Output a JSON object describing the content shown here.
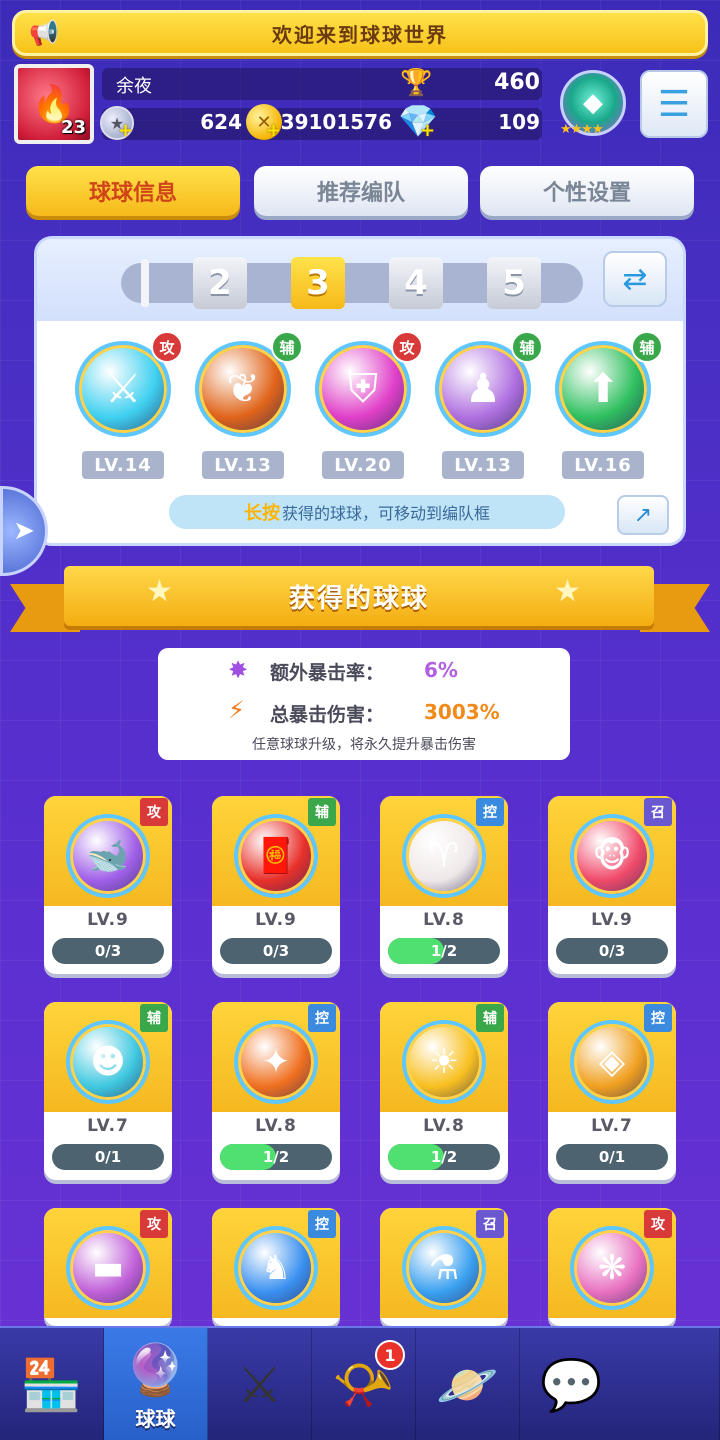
{
  "banner": {
    "text": "欢迎来到球球世界",
    "icon": "megaphone-icon"
  },
  "player": {
    "name": "余夜",
    "level": "23",
    "trophies": "460",
    "silver": "624",
    "gold": "39101576",
    "gems": "109",
    "rank_stars": "★★★★"
  },
  "tabs": [
    {
      "label": "球球信息",
      "active": true
    },
    {
      "label": "推荐编队",
      "active": false
    },
    {
      "label": "个性设置",
      "active": false
    }
  ],
  "team": {
    "slots": [
      "2",
      "3",
      "4",
      "5"
    ],
    "active_slot": "3",
    "balls": [
      {
        "tag": "攻",
        "tag_type": "atk",
        "level": "LV.14",
        "color": "#3fd0f0",
        "icon": "sword-icon"
      },
      {
        "tag": "辅",
        "tag_type": "sup",
        "level": "LV.13",
        "color": "#e0641a",
        "icon": "wings-icon"
      },
      {
        "tag": "攻",
        "tag_type": "atk",
        "level": "LV.20",
        "color": "#e040c8",
        "icon": "shield-bolt-icon"
      },
      {
        "tag": "辅",
        "tag_type": "sup",
        "level": "LV.13",
        "color": "#b070e0",
        "icon": "people-icon"
      },
      {
        "tag": "辅",
        "tag_type": "sup",
        "level": "LV.16",
        "color": "#30c060",
        "icon": "arrow-up-icon"
      }
    ],
    "hint_highlight": "长按",
    "hint_text": "获得的球球，可移动到编队框"
  },
  "collection": {
    "title": "获得的球球",
    "extra_crit_label": "额外暴击率：",
    "extra_crit_value": "6%",
    "total_crit_label": "总暴击伤害：",
    "total_crit_value": "3003%",
    "note": "任意球球升级，将永久提升暴击伤害"
  },
  "cards": [
    {
      "tag": "攻",
      "tag_type": "atk",
      "level": "LV.9",
      "progress_text": "0/3",
      "progress": 0.0,
      "color": "#a060e8",
      "icon": "whale-icon"
    },
    {
      "tag": "辅",
      "tag_type": "sup",
      "level": "LV.9",
      "progress_text": "0/3",
      "progress": 0.0,
      "color": "#e8302a",
      "icon": "red-envelope-icon"
    },
    {
      "tag": "控",
      "tag_type": "ctl",
      "level": "LV.8",
      "progress_text": "1/2",
      "progress": 0.5,
      "color": "#f0e8e8",
      "icon": "ram-icon"
    },
    {
      "tag": "召",
      "tag_type": "sum",
      "level": "LV.9",
      "progress_text": "0/3",
      "progress": 0.0,
      "color": "#f04a6a",
      "icon": "monkey-icon"
    },
    {
      "tag": "辅",
      "tag_type": "sup",
      "level": "LV.7",
      "progress_text": "0/1",
      "progress": 0.0,
      "color": "#40c8e0",
      "icon": "spirit-icon"
    },
    {
      "tag": "控",
      "tag_type": "ctl",
      "level": "LV.8",
      "progress_text": "1/2",
      "progress": 0.5,
      "color": "#f07020",
      "icon": "star-burst-icon"
    },
    {
      "tag": "辅",
      "tag_type": "sup",
      "level": "LV.8",
      "progress_text": "1/2",
      "progress": 0.5,
      "color": "#f8c020",
      "icon": "sun-icon"
    },
    {
      "tag": "控",
      "tag_type": "ctl",
      "level": "LV.7",
      "progress_text": "0/1",
      "progress": 0.0,
      "color": "#f0a020",
      "icon": "gem-icon"
    },
    {
      "tag": "攻",
      "tag_type": "atk",
      "level": "",
      "progress_text": "",
      "progress": 0.0,
      "color": "#c060d8",
      "icon": "belt-icon"
    },
    {
      "tag": "控",
      "tag_type": "ctl",
      "level": "",
      "progress_text": "",
      "progress": 0.0,
      "color": "#3a90f0",
      "icon": "figure-icon"
    },
    {
      "tag": "召",
      "tag_type": "sum",
      "level": "",
      "progress_text": "",
      "progress": 0.0,
      "color": "#3aa0f0",
      "icon": "potion-icon"
    },
    {
      "tag": "攻",
      "tag_type": "atk",
      "level": "",
      "progress_text": "",
      "progress": 0.0,
      "color": "#e870c0",
      "icon": "crystal-icon"
    }
  ],
  "nav": [
    {
      "name": "shop",
      "icon": "shop-icon",
      "label": "",
      "active": false,
      "badge": ""
    },
    {
      "name": "balls",
      "icon": "balls-icon",
      "label": "球球",
      "active": true,
      "badge": ""
    },
    {
      "name": "battle",
      "icon": "crossed-swords-icon",
      "label": "",
      "active": false,
      "badge": ""
    },
    {
      "name": "whistle",
      "icon": "whistle-icon",
      "label": "",
      "active": false,
      "badge": "1"
    },
    {
      "name": "planet",
      "icon": "planet-icon",
      "label": "",
      "active": false,
      "badge": ""
    },
    {
      "name": "chat",
      "icon": "chat-heart-icon",
      "label": "",
      "active": false,
      "badge": ""
    }
  ]
}
